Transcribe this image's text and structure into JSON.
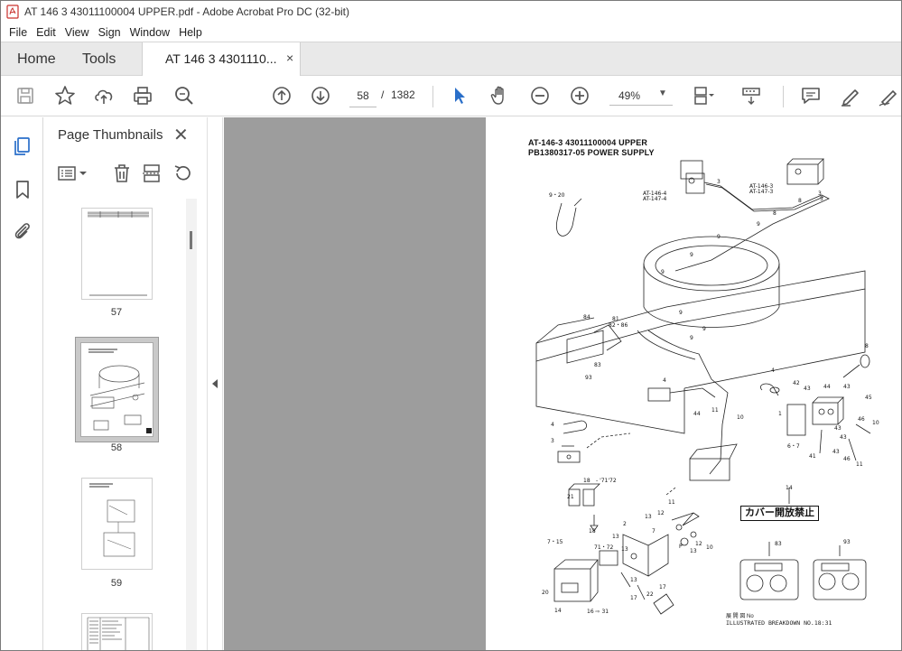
{
  "window": {
    "title": "AT 146 3 43011100004 UPPER.pdf - Adobe Acrobat Pro DC (32-bit)"
  },
  "menu": [
    "File",
    "Edit",
    "View",
    "Sign",
    "Window",
    "Help"
  ],
  "tabs": {
    "home": "Home",
    "tools": "Tools",
    "document": "AT 146 3 4301110...",
    "close": "×"
  },
  "toolbar": {
    "current_page": "58",
    "page_separator": "/",
    "total_pages": "1382",
    "zoom": "49%",
    "icons": [
      "save-icon",
      "star-icon",
      "upload-icon",
      "print-icon",
      "zoom-search-icon",
      "page-up-icon",
      "page-down-icon",
      "select-cursor-icon",
      "hand-icon",
      "zoom-out-icon",
      "zoom-in-icon",
      "page-fit-icon",
      "scroll-mode-icon",
      "comment-icon",
      "highlight-pen-icon",
      "sign-icon"
    ]
  },
  "thumbnails_panel": {
    "title": "Page Thumbnails",
    "close": "✕",
    "pages": [
      {
        "label": "57",
        "selected": false
      },
      {
        "label": "58",
        "selected": true
      },
      {
        "label": "59",
        "selected": false
      }
    ]
  },
  "document_page": {
    "header_line1": "AT-146-3 43011100004 UPPER",
    "header_line2": "PB1380317-05 POWER SUPPLY",
    "badge": "カバー開放禁止",
    "footer_line1": "展 開 図 No",
    "footer_line2": "ILLUSTRATED BREAKDOWN NO.18:31",
    "part_labels": {
      "at146": "AT-146-4",
      "at147": "AT-147-4",
      "at146b": "AT-146-3",
      "at147b": "AT-147-3",
      "n920": "9・20",
      "n67": "6・7",
      "n1871": "18 - '71'72",
      "n715": "7・15",
      "n7172": "71・72",
      "n1831": "16 ⇨ 31",
      "n8286": "82・86"
    }
  },
  "colors": {
    "accent_blue": "#2a6fc9",
    "doc_background": "#9d9d9d",
    "tabbar": "#e9e9e9"
  }
}
